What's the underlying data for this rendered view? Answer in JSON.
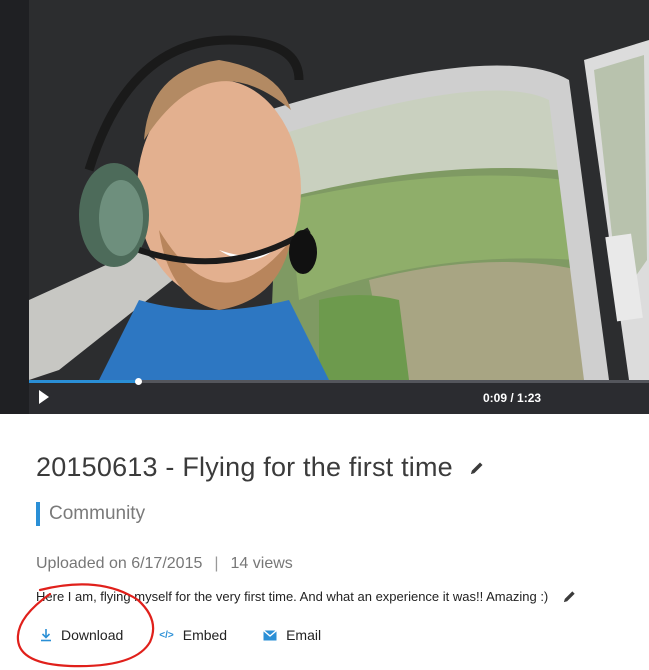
{
  "player": {
    "time_display": "0:09 / 1:23",
    "progress_fraction": 0.175,
    "play_icon": "play-icon",
    "accent_color": "#2a8fd6"
  },
  "video": {
    "title": "20150613 - Flying for the first time",
    "channel": "Community",
    "uploaded": "Uploaded on 6/17/2015",
    "separator": "|",
    "views": "14 views",
    "description": "Here I am, flying myself for the very first time. And what an experience it was!! Amazing :)",
    "edit_icon": "pencil-icon"
  },
  "actions": {
    "download_label": "Download",
    "embed_label": "Embed",
    "embed_icon_text": "</>",
    "email_label": "Email"
  },
  "annotation": {
    "color": "#e0201b"
  }
}
